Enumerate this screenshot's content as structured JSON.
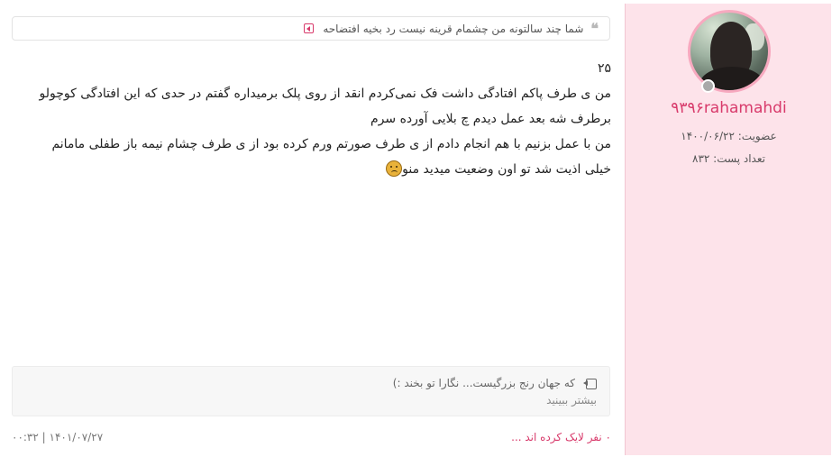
{
  "user": {
    "username": "۹۳۹۶rahamahdi",
    "join_label": "عضویت: ۱۴۰۰/۰۶/۲۲",
    "posts_label": "تعداد پست: ۸۳۲",
    "avatar_icon": "user-avatar-photo",
    "status_color": "#a9a9a9"
  },
  "quote": {
    "text": "شما چند سالتونه من چشمام قرینه نیست رد بخیه افتضاحه",
    "quote_icon": "quote-icon",
    "link_icon": "go-to-quoted-post-icon"
  },
  "post": {
    "number": "۲۵",
    "paragraph_1": "من ی طرف پاکم افتادگی داشت فک نمی‌کردم انقد از روی پلک برمیداره گفتم در حدی که این افتادگی کوچولو برطرف شه بعد عمل دیدم چ بلایی آورده سرم",
    "paragraph_2": "من با عمل بزنیم با هم انجام دادم از ی طرف صورتم ورم کرده بود از ی طرف چشام نیمه باز طفلی مامانم خیلی اذیت شد تو اون وضعیت میدید منو",
    "emoji_icon": "sad-face-emoji-icon"
  },
  "signature": {
    "text": "که جهان رنج بزرگیست...  نگارا تو بخند :)",
    "more_label": "بیشتر ببینید",
    "icon": "signature-arrow-icon"
  },
  "footer": {
    "likes_label": "۰ نفر لایک کرده اند ...",
    "date_label": "۰۰:۳۲ | ۱۴۰۱/۰۷/۲۷"
  },
  "colors": {
    "accent": "#d83a6b",
    "sidebar_bg": "#fde3ea",
    "avatar_border": "#f7a9bf"
  }
}
